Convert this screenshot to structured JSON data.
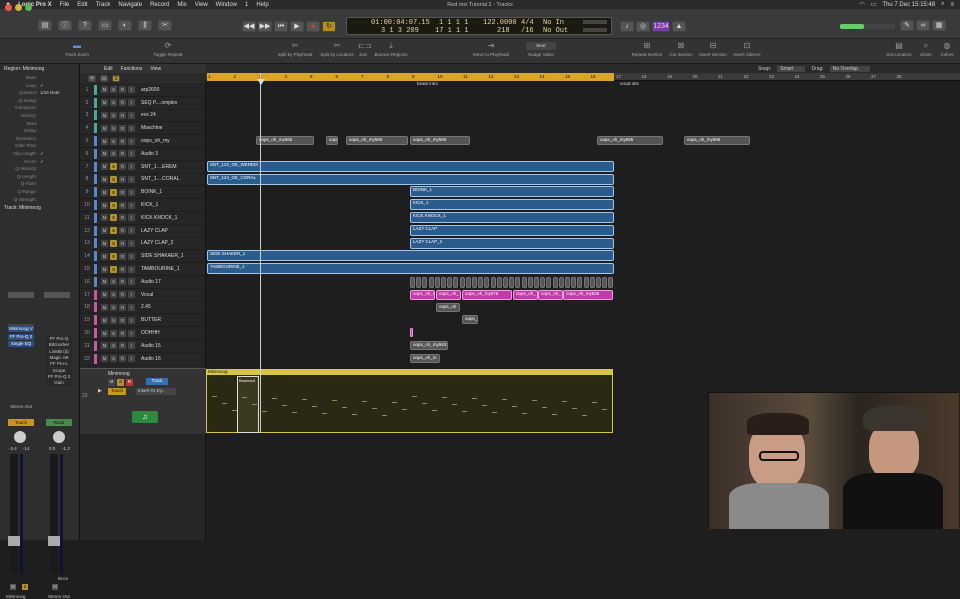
{
  "menubar": {
    "apple": "",
    "app_name": "Logic Pro X",
    "items": [
      "File",
      "Edit",
      "Track",
      "Navigate",
      "Record",
      "Mix",
      "View",
      "Window",
      "1",
      "Help"
    ],
    "right": "Thu 7 Dec 15:15:48"
  },
  "window_title": "Red mix Tutorial 2 - Tracks",
  "lcd": {
    "time": "01:00:04:07.15",
    "bars": "3 1 3 209",
    "pos_a": "1 1 1 1",
    "pos_b": "17 1 1 1",
    "bpm": "122.0000",
    "bpm2": "218",
    "sig": "4/4",
    "div": "/16",
    "in": "No In",
    "out": "No Out"
  },
  "toolbar": {
    "tools": [
      "Track Zoom",
      "Toggle Repeat",
      "Split by Playhead",
      "Split by Locators",
      "Join",
      "Bounce Regions",
      "Move to Playhead",
      "Nudge Value",
      "Repeat Section",
      "Cut Section",
      "Insert Section",
      "Insert Silence",
      "Set Locators",
      "Zoom",
      "Colors"
    ],
    "nudge": "Beat",
    "snap_label": "Snap:",
    "snap": "Smart",
    "drag_label": "Drag:",
    "drag": "No Overlap"
  },
  "inspector": {
    "region_label": "Region: Minimoog",
    "rows": [
      [
        "Mute:",
        ""
      ],
      [
        "Loop:",
        "✓"
      ],
      [
        "Quantize",
        "1/16 Note"
      ],
      [
        "Q-Swing:",
        ""
      ],
      [
        "Transpose:",
        ""
      ],
      [
        "Velocity:",
        ""
      ],
      [
        "More",
        ""
      ],
      [
        "Delay:",
        ""
      ],
      [
        "Dynamics:",
        ""
      ],
      [
        "Gate Time:",
        ""
      ],
      [
        "Clip Length:",
        "✓"
      ],
      [
        "Score:",
        "✓"
      ],
      [
        "Q-Velocity:",
        ""
      ],
      [
        "Q-Length:",
        ""
      ],
      [
        "Q-Flam:",
        ""
      ],
      [
        "Q-Range:",
        ""
      ],
      [
        "Q-Strength:",
        ""
      ]
    ],
    "track_label": "Track: Minimoog",
    "strip1": {
      "plugin": "Minimoog V",
      "eq": "FF Pro-Q 2",
      "eq2": "Single EQ",
      "out": "Stereo Out",
      "auto": "Touch",
      "vol": "-3.4",
      "pk": "-14",
      "name": "Minimoog"
    },
    "strip2": {
      "plugins": [
        "FF Pro-Q",
        "Bitcrusher",
        "LinMB (d)",
        "Magic AB",
        "FF Pro-L",
        "Scope",
        "FF Pro-Q 2",
        "Gain"
      ],
      "auto": "Read",
      "vol": "0.0",
      "pk": "-1.3",
      "name": "Stereo Out",
      "bnce": "Bnce"
    }
  },
  "tracklist_header": {
    "edit": "Edit",
    "functions": "Functions",
    "view": "View"
  },
  "tracks": [
    {
      "n": "1",
      "name": "arp2600"
    },
    {
      "n": "2",
      "name": "SEQ P....omplex"
    },
    {
      "n": "3",
      "name": "evs 24"
    },
    {
      "n": "4",
      "name": "Maschine"
    },
    {
      "n": "5",
      "name": "oops_oh_my"
    },
    {
      "n": "6",
      "name": "Audio 3"
    },
    {
      "n": "7",
      "name": "SNT_1....EREM"
    },
    {
      "n": "8",
      "name": "SNT_1....CORAL"
    },
    {
      "n": "9",
      "name": "BOINK_1"
    },
    {
      "n": "10",
      "name": "KICK_1"
    },
    {
      "n": "11",
      "name": "KICK KNOCK_1"
    },
    {
      "n": "12",
      "name": "LAZY CLAP"
    },
    {
      "n": "13",
      "name": "LAZY CLAP_2"
    },
    {
      "n": "14",
      "name": "SIDE SHAKAER_1"
    },
    {
      "n": "15",
      "name": "TAMBOURINE_1"
    },
    {
      "n": "16",
      "name": "Audio 17"
    },
    {
      "n": "17",
      "name": "Vocal"
    },
    {
      "n": "18",
      "name": "2.45"
    },
    {
      "n": "19",
      "name": "BUTTER"
    },
    {
      "n": "20",
      "name": "OOHHH"
    },
    {
      "n": "21",
      "name": "Audio 15"
    },
    {
      "n": "22",
      "name": "Audio 16"
    },
    {
      "n": "23",
      "name": "Minimoog"
    }
  ],
  "ruler": {
    "bars": [
      "1",
      "2",
      "3",
      "4",
      "5",
      "6",
      "7",
      "8",
      "9",
      "10",
      "11",
      "12",
      "13",
      "14",
      "15",
      "16",
      "17",
      "18",
      "19",
      "20",
      "21",
      "22",
      "23",
      "24",
      "25",
      "26",
      "27",
      "28"
    ],
    "markers": [
      "beats intro",
      "vocal oks"
    ]
  },
  "regions": {
    "oops": [
      "oops_oh_my560",
      "oops_oh_my560",
      "oops_oh_my560",
      "oops_oh_my560",
      "oops_oh_my560",
      "oops_oh_my595",
      "oops_oh_my586"
    ],
    "snt1": "SNT_122_GE_WEREM",
    "snt2": "SNT_124_GE_CORAL",
    "boink": "BOINK_1",
    "kick": "KICK_1",
    "kickknock": "KICK KNOCK_1",
    "lazy": "LAZY CLAP",
    "lazy2": "LAZY CLAP_2",
    "shaker": "SIDE SHAKER_1",
    "tamb": "TAMBOURINE_1",
    "vocal": [
      "oops_oh_m",
      "oops_oh_",
      "oops_oh_my576",
      "oops_oh_",
      "oops_oh_",
      "oops_oh_my626"
    ],
    "v2": "oops_oh",
    "butter": "oops_oh",
    "aud15": "oops_oh_my563",
    "aud16": "oops_oh_m",
    "minimoog": "Minimoog",
    "minisel": "Bounced"
  },
  "minimoog_track": {
    "name": "Minimoog",
    "m": "M",
    "s": "S",
    "r": "R",
    "track_btn": "Track",
    "touch": "Touch",
    "insert": "Insert #1 Ey..."
  }
}
